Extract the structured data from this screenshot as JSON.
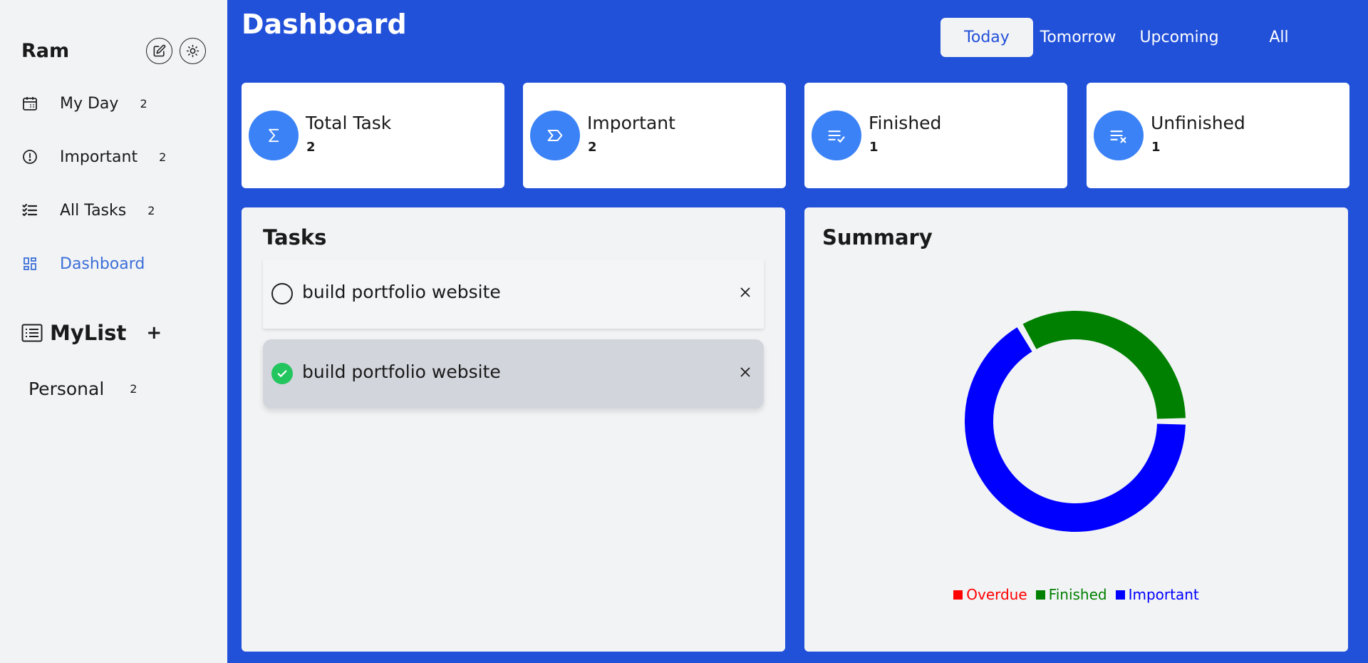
{
  "sidebar": {
    "user_name": "Ram",
    "nav": [
      {
        "label": "My Day",
        "count": "2",
        "icon": "calendar-icon"
      },
      {
        "label": "Important",
        "count": "2",
        "icon": "alert-circle-icon"
      },
      {
        "label": "All Tasks",
        "count": "2",
        "icon": "checklist-icon"
      },
      {
        "label": "Dashboard",
        "icon": "dashboard-icon"
      }
    ],
    "mylist_title": "MyList",
    "mylist_add": "+",
    "lists": [
      {
        "label": "Personal",
        "count": "2"
      }
    ]
  },
  "main": {
    "title": "Dashboard",
    "tabs": [
      "Today",
      "Tomorrow",
      "Upcoming",
      "All"
    ],
    "active_tab": "Today",
    "stats": [
      {
        "label": "Total Task",
        "value": "2",
        "icon": "sigma-icon"
      },
      {
        "label": "Important",
        "value": "2",
        "icon": "important-tag-icon"
      },
      {
        "label": "Finished",
        "value": "1",
        "icon": "list-check-icon"
      },
      {
        "label": "Unfinished",
        "value": "1",
        "icon": "list-x-icon"
      }
    ],
    "tasks_title": "Tasks",
    "tasks": [
      {
        "text": "build portfolio website",
        "done": false
      },
      {
        "text": "build portfolio website",
        "done": true
      }
    ],
    "summary_title": "Summary"
  },
  "colors": {
    "main_bg": "#2150d9",
    "accent": "#3b82f6",
    "active_nav": "#3b6fd8",
    "overdue": "#ff0000",
    "finished": "#008000",
    "important": "#0000ff"
  },
  "chart_data": {
    "type": "pie",
    "donut": true,
    "categories": [
      "Overdue",
      "Finished",
      "Important"
    ],
    "values": [
      0,
      1,
      2
    ],
    "colors": [
      "#ff0000",
      "#008000",
      "#0000ff"
    ],
    "legend": "bottom"
  }
}
